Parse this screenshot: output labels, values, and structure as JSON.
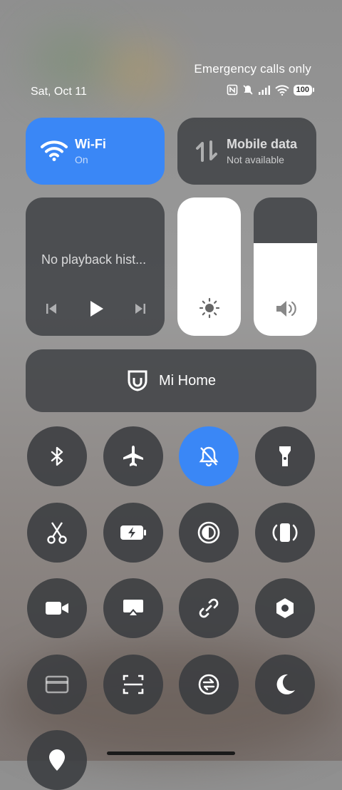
{
  "status_bar": {
    "carrier_text": "Emergency calls only",
    "date": "Sat, Oct 11",
    "battery": "100",
    "icons": [
      "nfc-icon",
      "silent-bell-icon",
      "signal-icon",
      "wifi-icon",
      "battery-icon"
    ]
  },
  "wifi": {
    "title": "Wi-Fi",
    "status": "On",
    "active": true
  },
  "mobile_data": {
    "title": "Mobile data",
    "status": "Not available",
    "active": false
  },
  "media": {
    "placeholder": "No playback hist..."
  },
  "brightness": {
    "level": 1.0
  },
  "volume": {
    "level": 0.67
  },
  "mi_home": {
    "label": "Mi Home"
  },
  "toggles": [
    {
      "icon": "bluetooth-icon",
      "active": false
    },
    {
      "icon": "airplane-icon",
      "active": false
    },
    {
      "icon": "silent-mode-icon",
      "active": true
    },
    {
      "icon": "flashlight-icon",
      "active": false
    },
    {
      "icon": "scissors-icon",
      "active": false
    },
    {
      "icon": "battery-saver-icon",
      "active": false
    },
    {
      "icon": "reading-mode-icon",
      "active": false
    },
    {
      "icon": "vibrate-icon",
      "active": false
    },
    {
      "icon": "video-camera-icon",
      "active": false
    },
    {
      "icon": "cast-icon",
      "active": false
    },
    {
      "icon": "link-icon",
      "active": false
    },
    {
      "icon": "settings-hex-icon",
      "active": false
    },
    {
      "icon": "card-icon",
      "active": false
    },
    {
      "icon": "scanner-icon",
      "active": false
    },
    {
      "icon": "sync-icon",
      "active": false
    },
    {
      "icon": "moon-icon",
      "active": false
    },
    {
      "icon": "location-icon",
      "active": false
    }
  ],
  "colors": {
    "accent": "#3a87f6",
    "tile": "#3c3e42"
  }
}
